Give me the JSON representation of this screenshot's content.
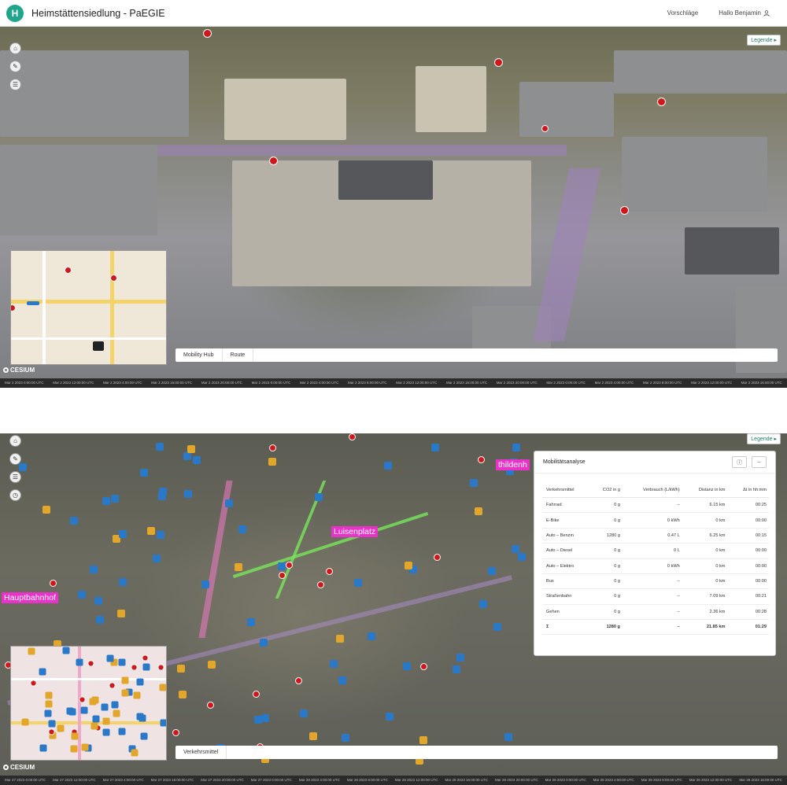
{
  "header": {
    "logo_letter": "H",
    "title": "Heimstättensiedlung - PaEGIE",
    "nav_suggestions": "Vorschläge",
    "user": "Hallo Benjamin"
  },
  "legend_label": "Legende ▸",
  "cesium_label": "CESIUM",
  "view1": {
    "tabs": [
      "Mobility Hub",
      "Route"
    ],
    "timeline_labels": [
      "Mar 2 2023 0:00:00 UTC",
      "Mar 2 2023 12:00:00 UTC",
      "Mar 2 2023 4:00:00 UTC",
      "Mar 2 2023 16:00:00 UTC",
      "Mar 2 2023 20:00:00 UTC",
      "Mar 2 2023 0:00:00 UTC",
      "Mar 2 2023 4:00:00 UTC",
      "Mar 2 2023 8:00:00 UTC",
      "Mar 2 2023 12:00:00 UTC",
      "Mar 2 2023 16:00:00 UTC",
      "Mar 2 2023 20:00:00 UTC",
      "Mar 2 2023 0:00:00 UTC",
      "Mar 2 2023 4:00:00 UTC",
      "Mar 2 2023 8:00:00 UTC",
      "Mar 2 2023 12:00:00 UTC",
      "Mar 2 2023 16:00:00 UTC"
    ]
  },
  "view2": {
    "tabs": [
      "Verkehrsmittel"
    ],
    "places": {
      "luisenplatz": "Luisenplatz",
      "hauptbahnhof": "Hauptbahnhof",
      "partial": "thildenh"
    },
    "timeline_labels": [
      "Mar 27 2023 0:00:00 UTC",
      "Mar 27 2023 12:00:00 UTC",
      "Mar 27 2023 4:00:00 UTC",
      "Mar 27 2023 16:00:00 UTC",
      "Mar 27 2023 20:00:00 UTC",
      "Mar 27 2023 0:00:00 UTC",
      "Mar 28 2023 4:00:00 UTC",
      "Mar 28 2023 8:00:00 UTC",
      "Mar 28 2023 12:00:00 UTC",
      "Mar 28 2023 16:00:00 UTC",
      "Mar 28 2023 20:00:00 UTC",
      "Mar 28 2023 0:00:00 UTC",
      "Mar 28 2023 4:00:00 UTC",
      "Mar 28 2023 8:00:00 UTC",
      "Mar 28 2023 12:00:00 UTC",
      "Mar 28 2023 16:00:00 UTC"
    ],
    "analysis": {
      "title": "Mobilitätsanalyse",
      "columns": [
        "Verkehrsmittel",
        "CO2 in g",
        "Verbrauch (L/kWh)",
        "Distanz in km",
        "Δt in hh:mm"
      ],
      "rows": [
        [
          "Fahrrad",
          "0 g",
          "–",
          "6.15 km",
          "00:25"
        ],
        [
          "E-Bike",
          "0 g",
          "0 kWh",
          "0 km",
          "00:00"
        ],
        [
          "Auto – Benzin",
          "1280 g",
          "0.47 L",
          "6.25 km",
          "00:15"
        ],
        [
          "Auto – Diesel",
          "0 g",
          "0 L",
          "0 km",
          "00:00"
        ],
        [
          "Auto – Elektro",
          "0 g",
          "0 kWh",
          "0 km",
          "00:00"
        ],
        [
          "Bus",
          "0 g",
          "–",
          "0 km",
          "00:00"
        ],
        [
          "Straßenbahn",
          "0 g",
          "–",
          "7.09 km",
          "00:21"
        ],
        [
          "Gehen",
          "0 g",
          "–",
          "2.36 km",
          "00:28"
        ]
      ],
      "total": [
        "Σ",
        "1280 g",
        "–",
        "21.85 km",
        "01:29"
      ]
    }
  }
}
